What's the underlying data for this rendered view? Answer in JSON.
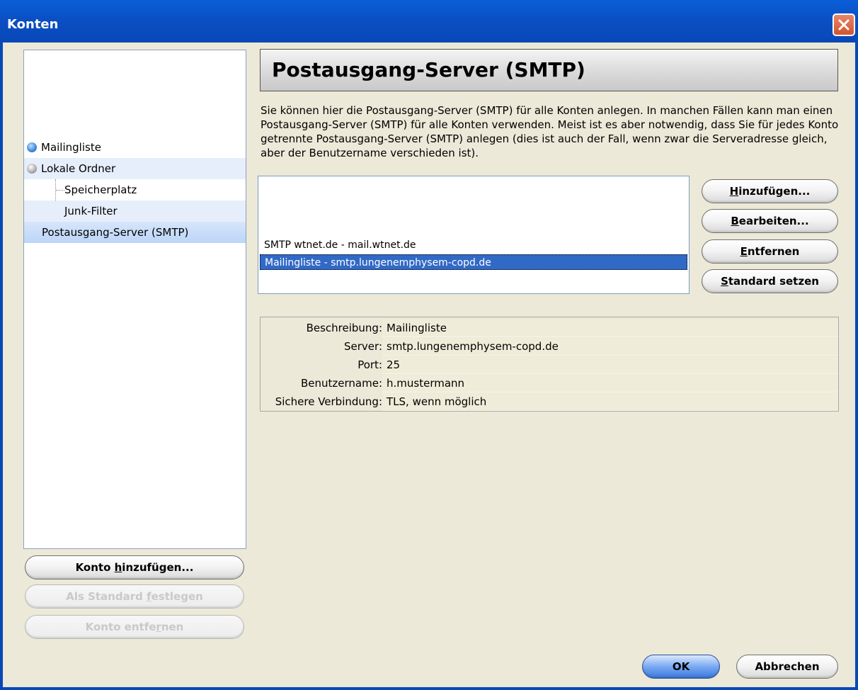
{
  "window": {
    "title": "Konten"
  },
  "tree": {
    "items": [
      {
        "label": "Mailingliste"
      },
      {
        "label": "Lokale Ordner"
      },
      {
        "label": "Speicherplatz"
      },
      {
        "label": "Junk-Filter"
      },
      {
        "label": "Postausgang-Server (SMTP)"
      }
    ]
  },
  "left_buttons": {
    "add_pre": "Konto ",
    "add_key": "h",
    "add_post": "inzufügen...",
    "default_pre": "Als Standard ",
    "default_key": "f",
    "default_post": "estlegen",
    "remove_pre": "Konto entfe",
    "remove_key": "r",
    "remove_post": "nen"
  },
  "header": {
    "title": "Postausgang-Server (SMTP)"
  },
  "description": "Sie können hier die Postausgang-Server (SMTP) für alle Konten anlegen. In manchen Fällen kann man einen Postausgang-Server (SMTP) für alle Konten verwenden. Meist ist es aber notwendig, dass Sie für jedes Konto getrennte Postausgang-Server (SMTP) anlegen (dies ist auch der Fall, wenn zwar die Serveradresse gleich, aber der Benutzername verschieden ist).",
  "server_list": {
    "items": [
      {
        "label": "SMTP wtnet.de - mail.wtnet.de"
      },
      {
        "label": "Mailingliste - smtp.lungenemphysem-copd.de",
        "selected": true
      }
    ]
  },
  "server_buttons": {
    "add_key": "H",
    "add_rest": "inzufügen...",
    "edit_key": "B",
    "edit_rest": "earbeiten...",
    "remove_key": "E",
    "remove_rest": "ntfernen",
    "default_key": "S",
    "default_rest": "tandard setzen"
  },
  "details": {
    "rows": [
      {
        "label": "Beschreibung:",
        "value": "Mailingliste"
      },
      {
        "label": "Server:",
        "value": "smtp.lungenemphysem-copd.de"
      },
      {
        "label": "Port:",
        "value": "25"
      },
      {
        "label": "Benutzername:",
        "value": "h.mustermann"
      },
      {
        "label": "Sichere Verbindung:",
        "value": "TLS, wenn möglich"
      }
    ]
  },
  "footer": {
    "ok": "OK",
    "cancel": "Abbrechen"
  }
}
